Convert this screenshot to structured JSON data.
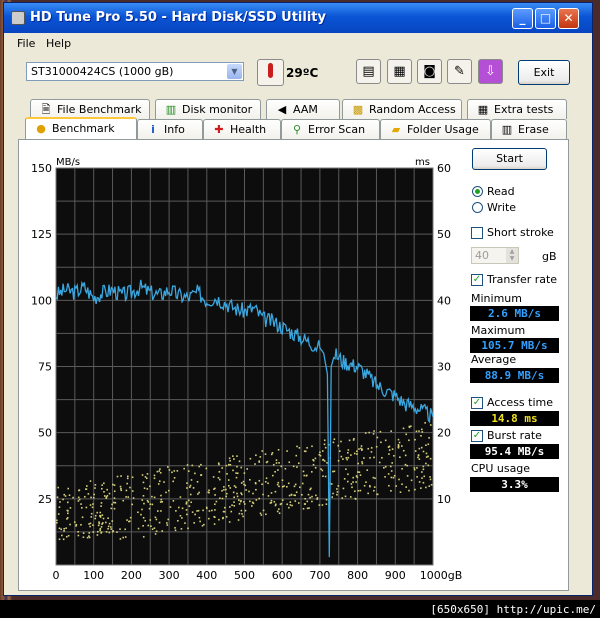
{
  "window": {
    "title": "HD Tune Pro 5.50 - Hard Disk/SSD Utility",
    "minimize": "_",
    "maximize": "□",
    "close": "✕"
  },
  "menu": {
    "file": "File",
    "help": "Help"
  },
  "toolbar": {
    "drive": "ST31000424CS (1000 gB)",
    "temperature": "29ºC",
    "exit_label": "Exit",
    "icons": [
      "copy-text-icon",
      "copy-all-icon",
      "camera-icon",
      "options-icon",
      "save-icon"
    ]
  },
  "tabs_row1": [
    {
      "label": "File Benchmark",
      "icon": "file-benchmark-icon"
    },
    {
      "label": "Disk monitor",
      "icon": "disk-monitor-icon"
    },
    {
      "label": "AAM",
      "icon": "speaker-icon"
    },
    {
      "label": "Random Access",
      "icon": "random-access-icon"
    },
    {
      "label": "Extra tests",
      "icon": "extra-tests-icon"
    }
  ],
  "tabs_row2": [
    {
      "label": "Benchmark",
      "icon": "benchmark-icon",
      "active": true
    },
    {
      "label": "Info",
      "icon": "info-icon"
    },
    {
      "label": "Health",
      "icon": "health-icon"
    },
    {
      "label": "Error Scan",
      "icon": "magnifier-icon"
    },
    {
      "label": "Folder Usage",
      "icon": "folder-icon"
    },
    {
      "label": "Erase",
      "icon": "trash-icon"
    }
  ],
  "side": {
    "start": "Start",
    "read": "Read",
    "write": "Write",
    "read_selected": true,
    "short_stroke": "Short stroke",
    "short_stroke_checked": false,
    "stroke_value": "40",
    "stroke_unit": "gB",
    "transfer_rate": "Transfer rate",
    "transfer_rate_checked": true,
    "minimum_label": "Minimum",
    "minimum": "2.6 MB/s",
    "maximum_label": "Maximum",
    "maximum": "105.7 MB/s",
    "average_label": "Average",
    "average": "88.9 MB/s",
    "access_time": "Access time",
    "access_time_checked": true,
    "access_value": "14.8 ms",
    "burst_rate": "Burst rate",
    "burst_rate_checked": true,
    "burst_value": "95.4 MB/s",
    "cpu_label": "CPU usage",
    "cpu_value": "3.3%"
  },
  "chart_data": {
    "type": "line",
    "ylabel": "MB/s",
    "y2label": "ms",
    "ylim": [
      0,
      150
    ],
    "y2lim": [
      0,
      60
    ],
    "xlim": [
      0,
      1000
    ],
    "yticks": [
      "150",
      "125",
      "100",
      "75",
      "50",
      "25"
    ],
    "y2ticks": [
      "60",
      "50",
      "40",
      "30",
      "20",
      "10"
    ],
    "xticks": [
      "0",
      "100",
      "200",
      "300",
      "400",
      "500",
      "600",
      "700",
      "800",
      "900",
      "1000gB"
    ],
    "grid": true,
    "series": [
      {
        "x": [
          0,
          25,
          50,
          75,
          100,
          125,
          150,
          175,
          200,
          225,
          250,
          275,
          300,
          325,
          350,
          375,
          400,
          425,
          450,
          475,
          500,
          525,
          550,
          575,
          600,
          625,
          650,
          675,
          700,
          710,
          720,
          725,
          730,
          740,
          760,
          780,
          800,
          825,
          850,
          875,
          900,
          925,
          950,
          975,
          1000
        ],
        "y": [
          102,
          104,
          103,
          105,
          101,
          103,
          104,
          102,
          103,
          105,
          103,
          102,
          104,
          102,
          101,
          103,
          100,
          101,
          99,
          97,
          96,
          97,
          93,
          92,
          90,
          88,
          86,
          84,
          82,
          80,
          72,
          3,
          75,
          80,
          77,
          76,
          75,
          72,
          68,
          66,
          64,
          61,
          60,
          58,
          56
        ],
        "color": "#3aa7e0"
      },
      {
        "type": "scatter",
        "color": "#d6d07a",
        "x_range": [
          0,
          1000
        ],
        "y2_range_ms": [
          6,
          24
        ],
        "note_access": "access time 14.8 ms average"
      }
    ]
  },
  "footer": "[650x650] http://upic.me/"
}
